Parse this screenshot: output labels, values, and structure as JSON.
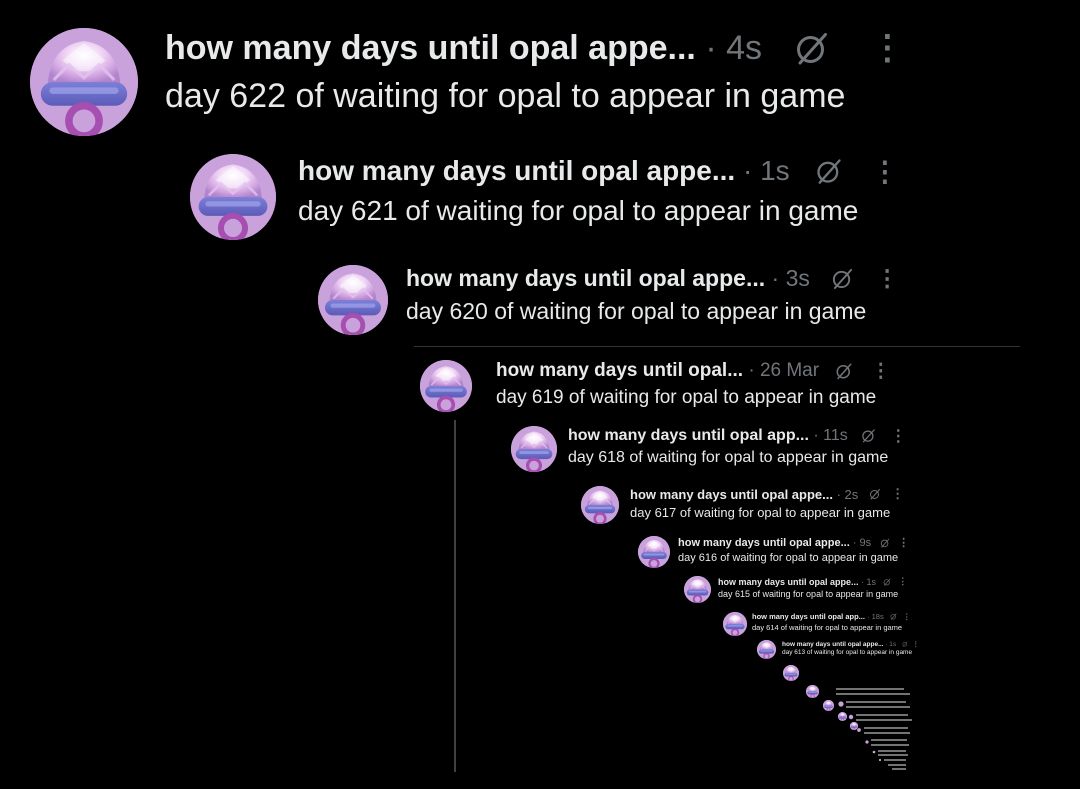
{
  "posts": [
    {
      "name": "how many days until opal appe...",
      "time": "4s",
      "text": "day 622 of waiting for opal to appear in game"
    },
    {
      "name": "how many days until opal appe...",
      "time": "1s",
      "text": "day 621 of waiting for opal to appear in game"
    },
    {
      "name": "how many days until opal appe...",
      "time": "3s",
      "text": "day 620 of waiting for opal to appear in game"
    },
    {
      "name": "how many days until opal...",
      "time": "26 Mar",
      "text": "day 619 of waiting for opal to appear in game"
    },
    {
      "name": "how many days until opal app...",
      "time": "11s",
      "text": "day 618 of waiting for opal to appear in game"
    },
    {
      "name": "how many days until opal appe...",
      "time": "2s",
      "text": "day 617 of waiting for opal to appear in game"
    },
    {
      "name": "how many days until opal appe...",
      "time": "9s",
      "text": "day 616 of waiting for opal to appear in game"
    },
    {
      "name": "how many days until opal appe...",
      "time": "1s",
      "text": "day 615 of waiting for opal to appear in game"
    },
    {
      "name": "how many days until opal app...",
      "time": "18s",
      "text": "day 614 of waiting for opal to appear in game"
    },
    {
      "name": "how many days until opal appe...",
      "time": "1s",
      "text": "day 613 of waiting for opal to appear in game"
    }
  ],
  "colors": {
    "background": "#000000",
    "name_text": "#e7e9ea",
    "meta_text": "#71767b",
    "avatar": "#c9a2dc"
  },
  "icons": {
    "avatar": "opal-pacifier-avatar",
    "grok": "grok-icon",
    "more": "more-icon"
  }
}
